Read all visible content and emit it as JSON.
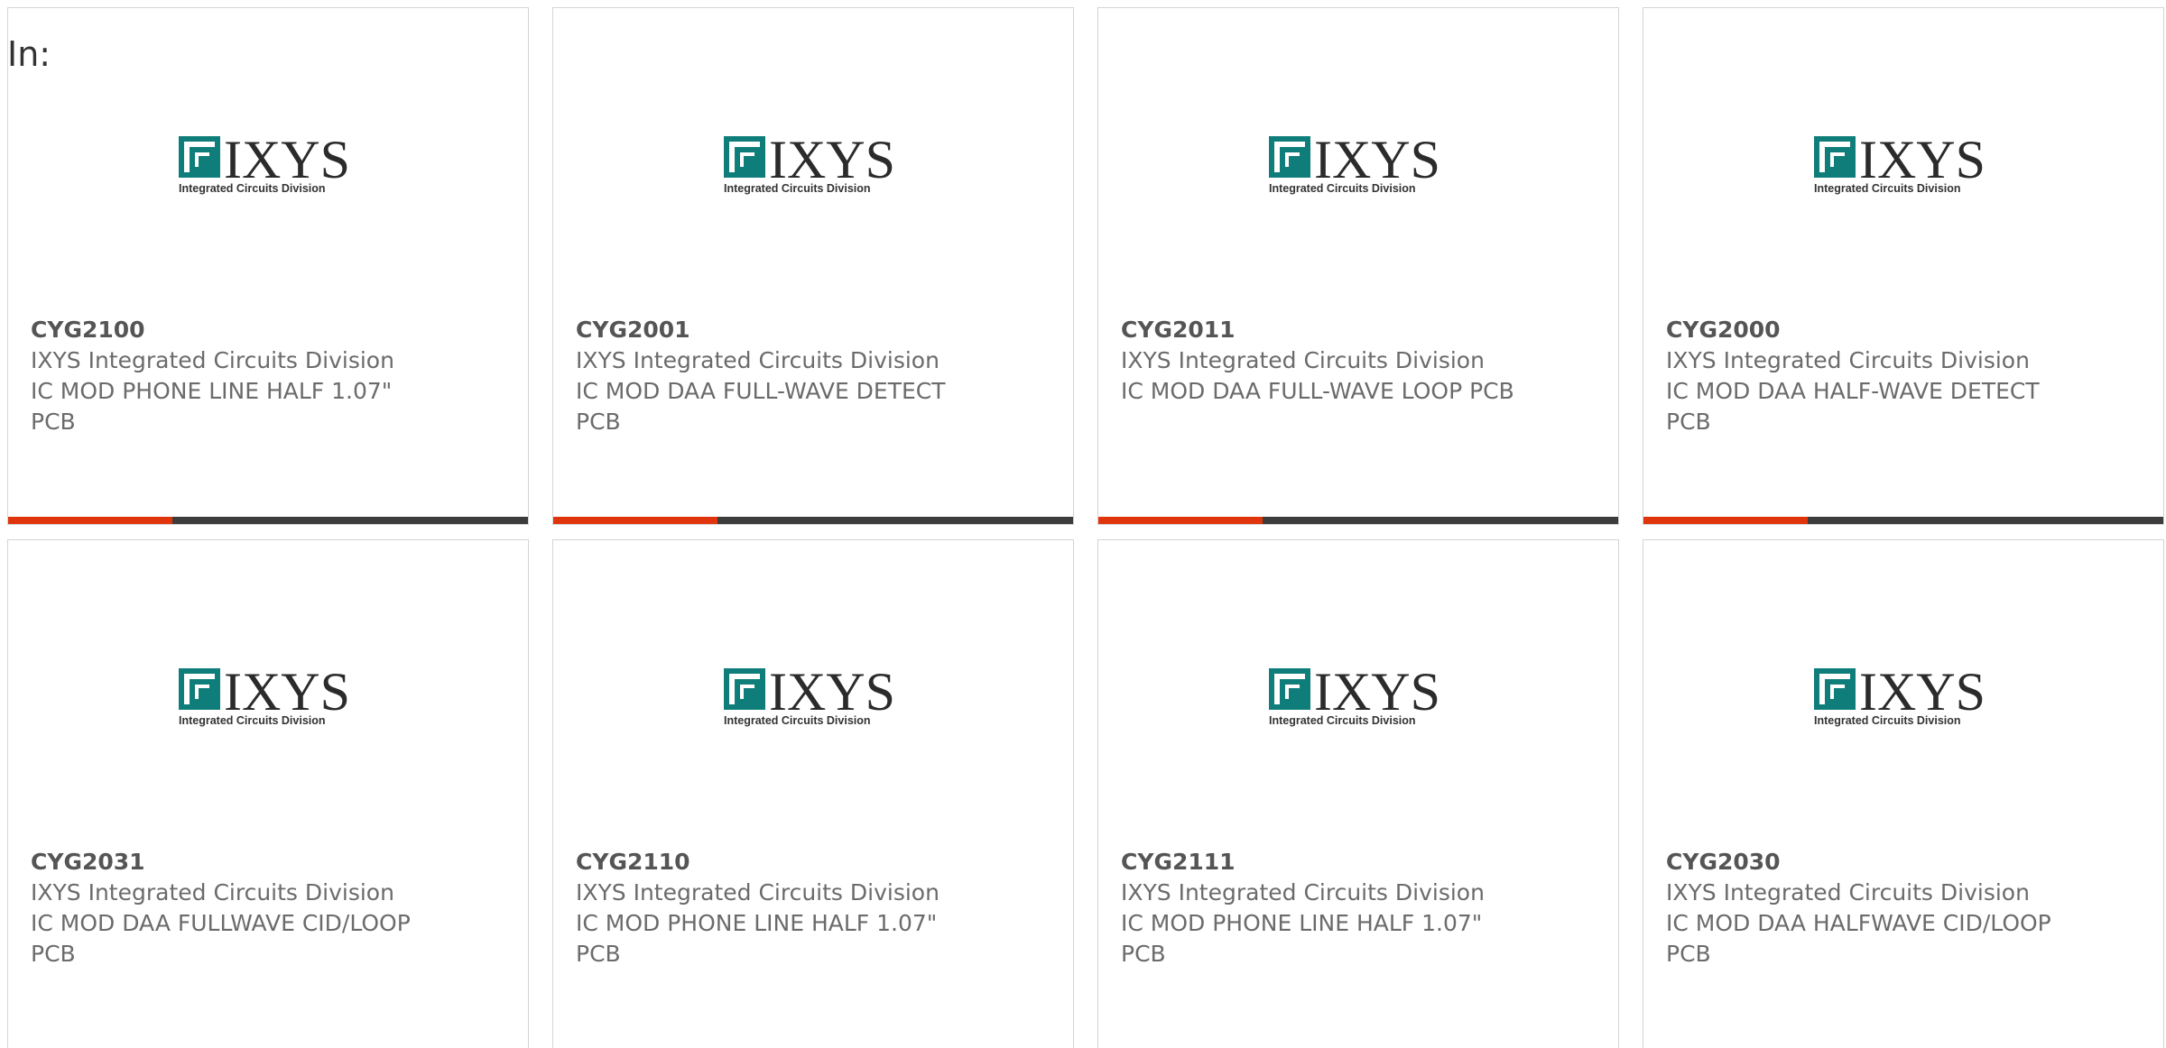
{
  "header": {
    "in_label": "In:"
  },
  "brand": {
    "logo_text": "IXYS",
    "logo_subtext": "Integrated Circuits Division",
    "logo_color": "#0f7e7b",
    "accent_color": "#e0340c",
    "bar_color": "#3c3c3c"
  },
  "products": [
    {
      "part": "CYG2100",
      "manufacturer": "IXYS Integrated Circuits Division",
      "description": "IC MOD PHONE LINE HALF 1.07\" PCB"
    },
    {
      "part": "CYG2001",
      "manufacturer": "IXYS Integrated Circuits Division",
      "description": "IC MOD DAA FULL-WAVE DETECT PCB"
    },
    {
      "part": "CYG2011",
      "manufacturer": "IXYS Integrated Circuits Division",
      "description": "IC MOD DAA FULL-WAVE LOOP PCB"
    },
    {
      "part": "CYG2000",
      "manufacturer": "IXYS Integrated Circuits Division",
      "description": "IC MOD DAA HALF-WAVE DETECT PCB"
    },
    {
      "part": "CYG2031",
      "manufacturer": "IXYS Integrated Circuits Division",
      "description": "IC MOD DAA FULLWAVE CID/LOOP PCB"
    },
    {
      "part": "CYG2110",
      "manufacturer": "IXYS Integrated Circuits Division",
      "description": "IC MOD PHONE LINE HALF 1.07\" PCB"
    },
    {
      "part": "CYG2111",
      "manufacturer": "IXYS Integrated Circuits Division",
      "description": "IC MOD PHONE LINE HALF 1.07\" PCB"
    },
    {
      "part": "CYG2030",
      "manufacturer": "IXYS Integrated Circuits Division",
      "description": "IC MOD DAA HALFWAVE CID/LOOP PCB"
    }
  ]
}
